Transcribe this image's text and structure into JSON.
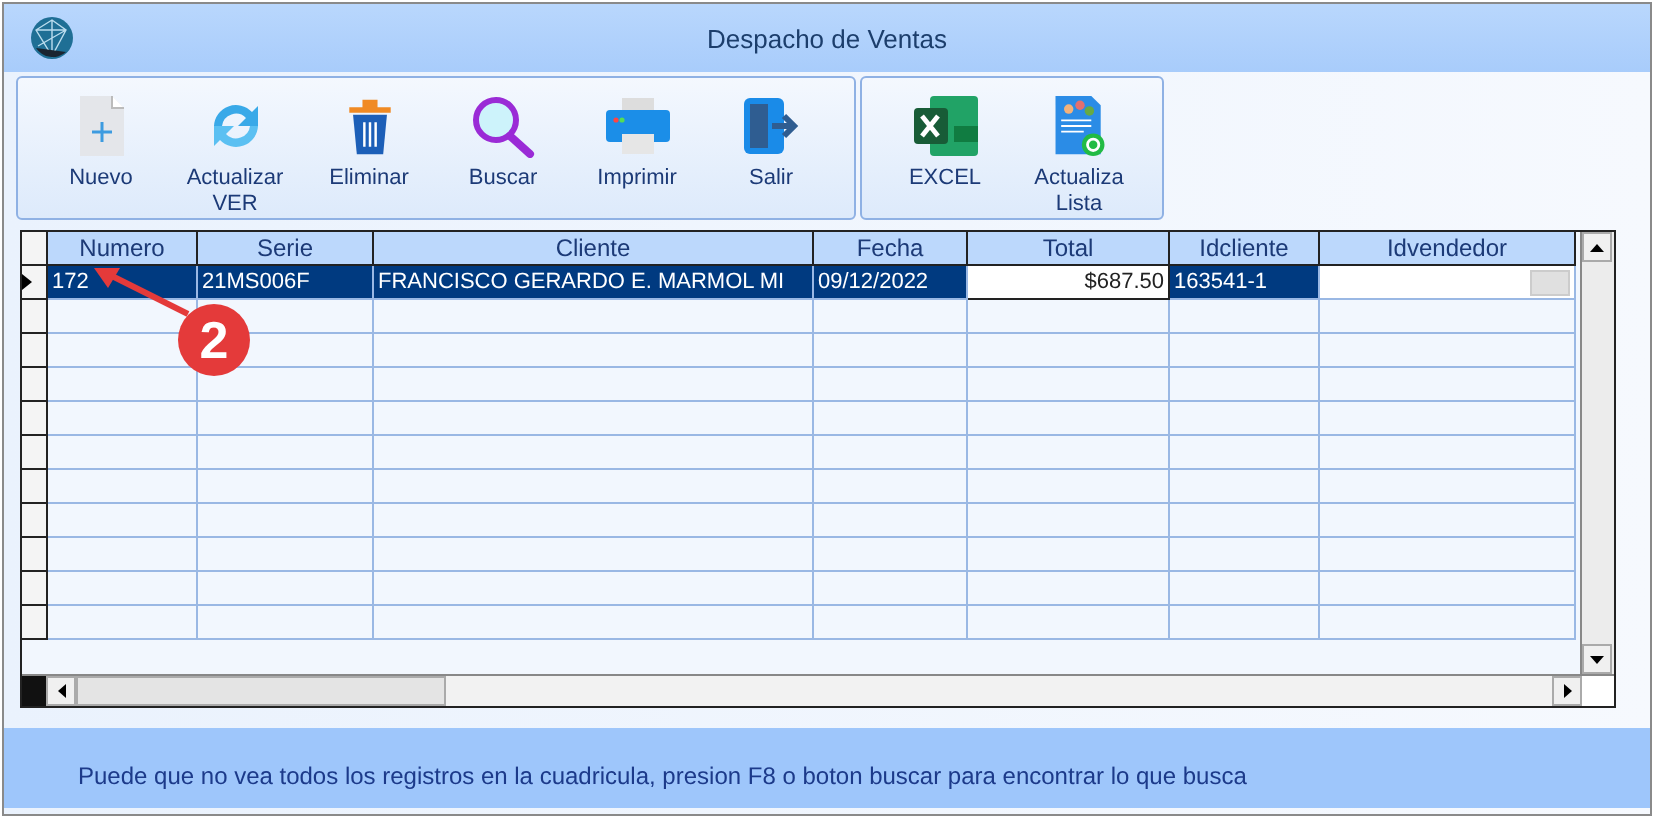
{
  "window": {
    "title": "Despacho de Ventas"
  },
  "toolbar": {
    "groups": [
      {
        "buttons": [
          {
            "kind": "new",
            "label": "Nuevo"
          },
          {
            "kind": "refresh",
            "label": "Actualizar VER"
          },
          {
            "kind": "delete",
            "label": "Eliminar"
          },
          {
            "kind": "search",
            "label": "Buscar"
          },
          {
            "kind": "print",
            "label": "Imprimir"
          },
          {
            "kind": "exit",
            "label": "Salir"
          }
        ]
      },
      {
        "buttons": [
          {
            "kind": "excel",
            "label": "EXCEL"
          },
          {
            "kind": "list",
            "label": "Actualiza Lista"
          }
        ]
      }
    ]
  },
  "table": {
    "columns": [
      "Numero",
      "Serie",
      "Cliente",
      "Fecha",
      "Total",
      "Idcliente",
      "Idvendedor"
    ],
    "rows": [
      {
        "selected": true,
        "cells": [
          {
            "kind": "text",
            "text": "172",
            "current": false
          },
          {
            "kind": "text",
            "text": "21MS006F",
            "current": false
          },
          {
            "kind": "text",
            "text": "FRANCISCO GERARDO E. MARMOL MI",
            "current": false
          },
          {
            "kind": "text",
            "text": "09/12/2022",
            "current": false
          },
          {
            "kind": "number",
            "text": "$687.50",
            "current": true
          },
          {
            "kind": "text",
            "text": "163541-1",
            "current": false
          },
          {
            "kind": "dropdown",
            "current": false
          }
        ]
      }
    ]
  },
  "callout": {
    "label": "2"
  },
  "status_text": "Puede que no vea todos los registros en la cuadricula, presion F8 o boton buscar para encontrar lo que busca"
}
